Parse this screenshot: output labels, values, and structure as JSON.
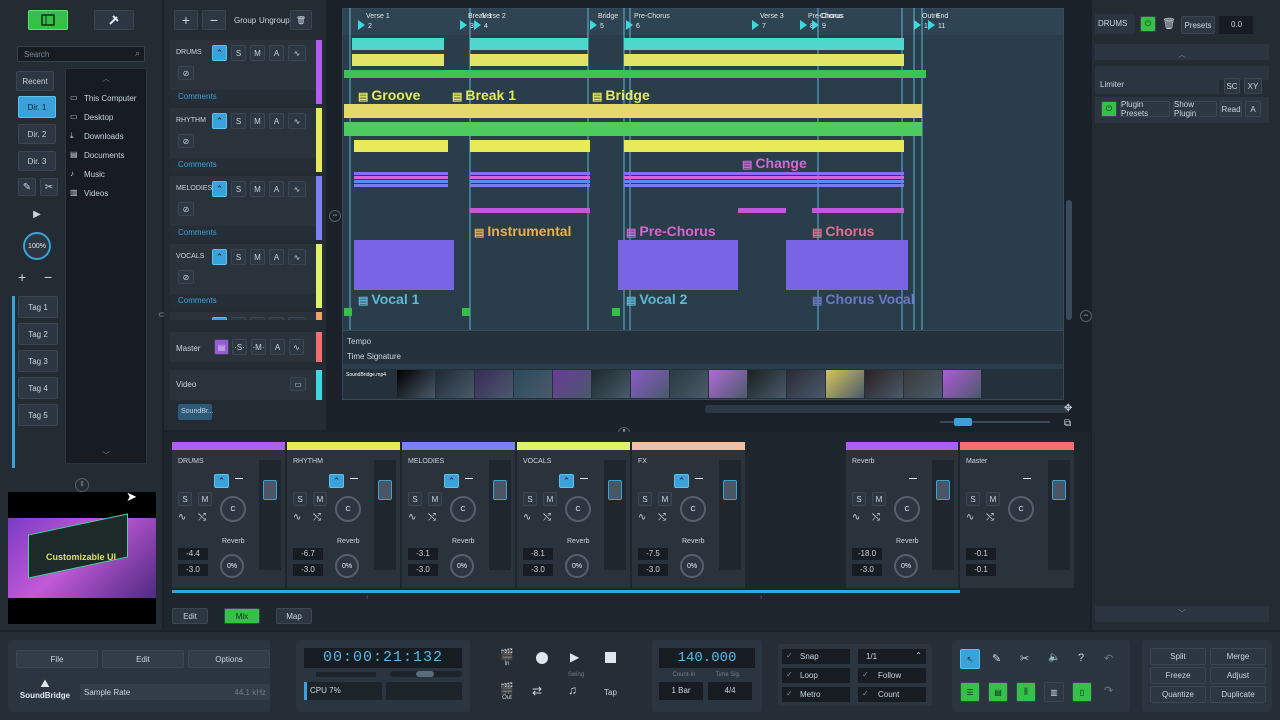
{
  "app": {
    "brand": "SoundBridge"
  },
  "sidebar": {
    "recent": "Recent",
    "dirs": [
      "Dir. 1",
      "Dir. 2",
      "Dir. 3"
    ],
    "zoom": "100%",
    "tags": [
      "Tag 1",
      "Tag 2",
      "Tag 3",
      "Tag 4",
      "Tag 5"
    ],
    "search_placeholder": "Search",
    "locations": [
      "This Computer",
      "Desktop",
      "Downloads",
      "Documents",
      "Music",
      "Videos"
    ],
    "preview_caption": "Customizable UI"
  },
  "tracks_toolbar": {
    "add": "+",
    "remove": "−",
    "group": "Group",
    "ungroup": "Ungroup"
  },
  "tracks": [
    {
      "name": "DRUMS",
      "color": "#b25cf0",
      "comments": "Comments"
    },
    {
      "name": "RHYTHM",
      "color": "#e6e95a",
      "comments": "Comments"
    },
    {
      "name": "MELODIES",
      "color": "#7b82f0",
      "comments": "Comments"
    },
    {
      "name": "VOCALS",
      "color": "#dff36a",
      "comments": "Comments"
    },
    {
      "name": "FX",
      "color": "#f0a06a",
      "comments": ""
    }
  ],
  "master_track": {
    "name": "Master"
  },
  "video_track": {
    "name": "Video",
    "clip": "SoundBr..."
  },
  "track_buttons": {
    "s": "S",
    "m": "M",
    "a": "A"
  },
  "timeline": {
    "markers": [
      {
        "num": "2",
        "label": "Verse 1"
      },
      {
        "num": "3",
        "label": "Break 1"
      },
      {
        "num": "4",
        "label": "Verse 2"
      },
      {
        "num": "5",
        "label": "Bridge"
      },
      {
        "num": "6",
        "label": "Pre-Chorus"
      },
      {
        "num": "7",
        "label": "Verse 3"
      },
      {
        "num": "8",
        "label": "Pre-Chorus"
      },
      {
        "num": "9",
        "label": "Chorus"
      },
      {
        "num": "10",
        "label": "Outro"
      },
      {
        "num": "11",
        "label": "End"
      }
    ],
    "clips": [
      "Groove",
      "Break 1",
      "Bridge",
      "Change",
      "Instrumental",
      "Pre-Chorus",
      "Chorus",
      "Vocal 1",
      "Vocal 2",
      "Chorus Vocal"
    ],
    "tempo": "Tempo",
    "timesig": "Time Signature",
    "video_file": "SoundBridge.mp4"
  },
  "right_panel": {
    "track": "DRUMS",
    "presets": "Presets",
    "value": "0.0",
    "plugin": "Limiter",
    "sc": "SC",
    "xy": "XY",
    "plugin_presets": "Plugin Presets",
    "show_plugin": "Show Plugin",
    "read": "Read",
    "a": "A"
  },
  "mixer": {
    "channels": [
      {
        "name": "DRUMS",
        "color": "#b25cf0",
        "vol": "-4.4",
        "pan": "-3.0",
        "send": "Reverb",
        "send_val": "0%"
      },
      {
        "name": "RHYTHM",
        "color": "#e6e95a",
        "vol": "-6.7",
        "pan": "-3.0",
        "send": "Reverb",
        "send_val": "0%"
      },
      {
        "name": "MELODIES",
        "color": "#7b82f0",
        "vol": "-3.1",
        "pan": "-3.0",
        "send": "Reverb",
        "send_val": "0%"
      },
      {
        "name": "VOCALS",
        "color": "#dff36a",
        "vol": "-8.1",
        "pan": "-3.0",
        "send": "Reverb",
        "send_val": "0%"
      },
      {
        "name": "FX",
        "color": "#f0c0a0",
        "vol": "-7.5",
        "pan": "-3.0",
        "send": "Reverb",
        "send_val": "0%"
      }
    ],
    "reverb": {
      "name": "Reverb",
      "vol": "-18.0",
      "pan": "-3.0",
      "send": "Reverb",
      "send_val": "0%"
    },
    "master": {
      "name": "Master",
      "vol": "-0.1",
      "pan": "-0.1"
    },
    "knob_label": "C",
    "tabs": [
      "Edit",
      "Mix",
      "Map"
    ]
  },
  "transport": {
    "menu": [
      "File",
      "Edit",
      "Options"
    ],
    "sample_rate_label": "Sample Rate",
    "sample_rate": "44.1 kHz",
    "cpu": "CPU 7%",
    "time": "00:00:21:132",
    "tempo": "140.000",
    "count_in": "Count-In",
    "time_sig_label": "Time Sig.",
    "bars": "1 Bar",
    "sig": "4/4",
    "in": "In",
    "out": "Out",
    "swing": "Swing",
    "tap": "Tap",
    "snap": "Snap",
    "loop": "Loop",
    "metro": "Metro",
    "grid": "1/1",
    "follow": "Follow",
    "count": "Count",
    "split": "Split",
    "merge": "Merge",
    "freeze": "Freeze",
    "adjust": "Adjust",
    "quantize": "Quantize",
    "duplicate": "Duplicate"
  },
  "colors": {
    "accent": "#3aa2d8",
    "green": "#35c04a",
    "bg": "#1a2128"
  }
}
